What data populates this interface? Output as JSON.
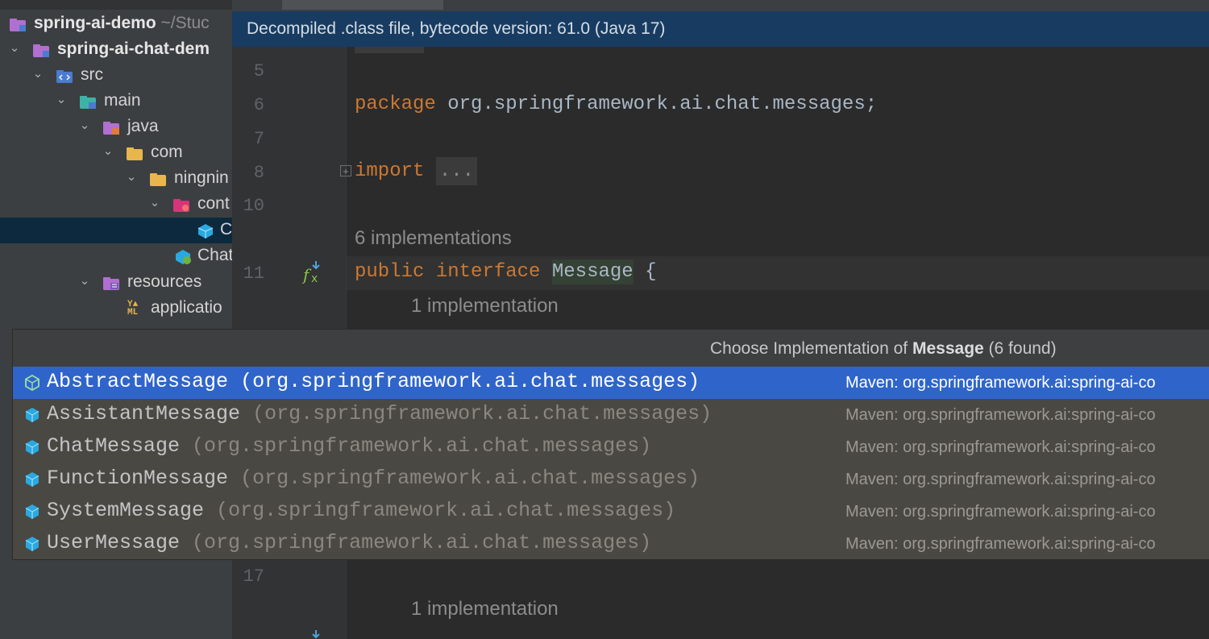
{
  "tree": {
    "items": [
      {
        "label": "spring-ai-demo",
        "suffix": "~/Stuc",
        "bold": true
      },
      {
        "label": "spring-ai-chat-dem",
        "bold": true
      },
      {
        "label": "src"
      },
      {
        "label": "main"
      },
      {
        "label": "java"
      },
      {
        "label": "com"
      },
      {
        "label": "ningnin"
      },
      {
        "label": "cont"
      },
      {
        "label": "C"
      },
      {
        "label": "Chat"
      },
      {
        "label": "resources"
      },
      {
        "label": "applicatio"
      }
    ]
  },
  "editor": {
    "banner": "Decompiled .class file, bytecode version: 61.0 (Java 17)",
    "lines": {
      "n5": "5",
      "n6": "6",
      "n7": "7",
      "n8": "8",
      "n10": "10",
      "n11": "11",
      "n17": "17"
    },
    "code": {
      "package_kw": "package",
      "package_name": "org.springframework.ai.chat.messages;",
      "import_kw": "import",
      "import_dots": "...",
      "hint_impls": "6 implementations",
      "public_kw": "public",
      "interface_kw": "interface",
      "interface_name": "Message",
      "brace": "{",
      "hint_one": "1 implementation",
      "hint_one_b": "1 implementation"
    }
  },
  "popup": {
    "title_prefix": "Choose Implementation of",
    "title_name": "Message",
    "title_suffix": "(6 found)",
    "rows": [
      {
        "name": "AbstractMessage",
        "pkg": "(org.springframework.ai.chat.messages)",
        "source": "Maven: org.springframework.ai:spring-ai-co"
      },
      {
        "name": "AssistantMessage",
        "pkg": "(org.springframework.ai.chat.messages)",
        "source": "Maven: org.springframework.ai:spring-ai-co"
      },
      {
        "name": "ChatMessage",
        "pkg": "(org.springframework.ai.chat.messages)",
        "source": "Maven: org.springframework.ai:spring-ai-co"
      },
      {
        "name": "FunctionMessage",
        "pkg": "(org.springframework.ai.chat.messages)",
        "source": "Maven: org.springframework.ai:spring-ai-co"
      },
      {
        "name": "SystemMessage",
        "pkg": "(org.springframework.ai.chat.messages)",
        "source": "Maven: org.springframework.ai:spring-ai-co"
      },
      {
        "name": "UserMessage",
        "pkg": "(org.springframework.ai.chat.messages)",
        "source": "Maven: org.springframework.ai:spring-ai-co"
      }
    ]
  },
  "colors": {
    "keyword": "#cc7832",
    "selection": "#2f65ca",
    "banner": "#183c61"
  }
}
